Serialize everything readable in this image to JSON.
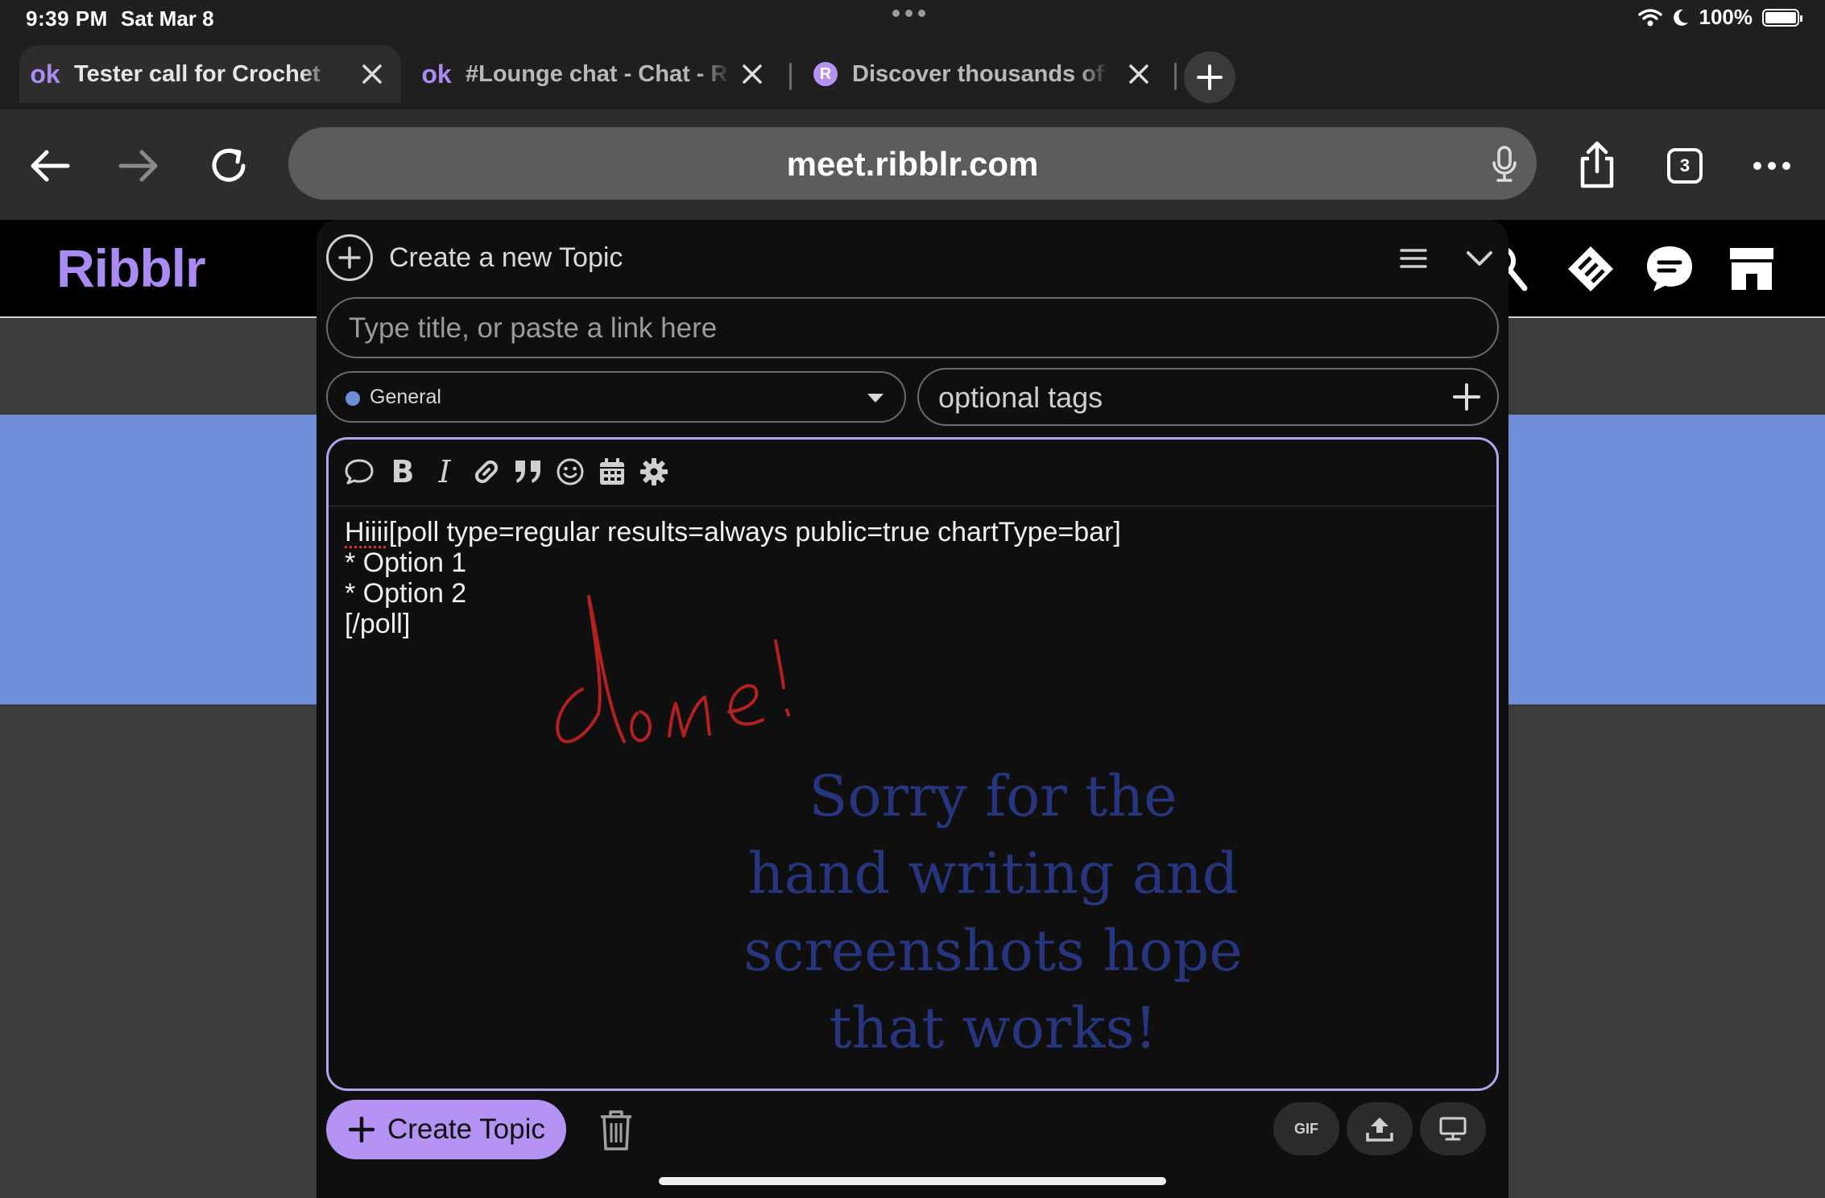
{
  "status_bar": {
    "time": "9:39 PM",
    "date": "Sat Mar 8",
    "battery": "100%"
  },
  "tabs": [
    {
      "label": "Tester call for Crochet",
      "favicon": "ok",
      "active": true
    },
    {
      "label": "#Lounge chat - Chat - R",
      "favicon": "ok",
      "active": false
    },
    {
      "label": "Discover thousands of c",
      "favicon": "R",
      "active": false
    }
  ],
  "browser": {
    "url": "meet.ribblr.com",
    "tab_count": "3"
  },
  "site": {
    "logo": "Ribblr"
  },
  "composer": {
    "header_title": "Create a new Topic",
    "title_placeholder": "Type title, or paste a link here",
    "category": "General",
    "tags_placeholder": "optional tags",
    "content_first_word": "Hiiii",
    "content_rest_line1": "[poll type=regular results=always public=true chartType=bar]",
    "content_line2": "* Option 1",
    "content_line3": "* Option 2",
    "content_line4": "[/poll]",
    "handwritten": "done!",
    "note": "Sorry for the hand writing and screenshots hope that works!",
    "create_button": "Create Topic",
    "gif_label": "GIF"
  },
  "colors": {
    "accent": "#b493f5",
    "logo": "#a98bf3",
    "category_dot": "#6f8ed8",
    "handwriting": "#b32020",
    "note_text": "#26357e",
    "page_band": "#6f8ed8"
  }
}
